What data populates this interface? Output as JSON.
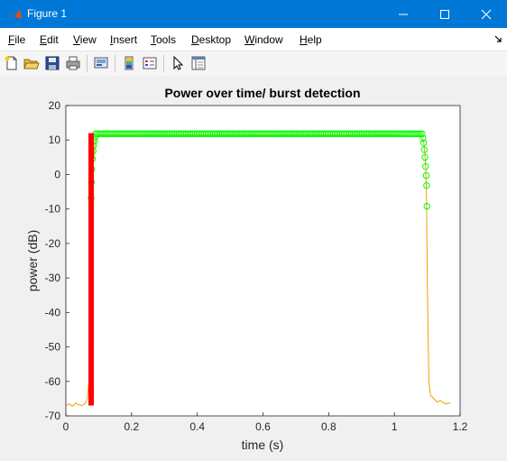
{
  "window": {
    "title": "Figure 1",
    "colors": {
      "titlebar": "#0078d7"
    }
  },
  "menu": {
    "items": [
      {
        "label": "File",
        "accel": "F",
        "rest": "ile"
      },
      {
        "label": "Edit",
        "accel": "E",
        "rest": "dit"
      },
      {
        "label": "View",
        "accel": "V",
        "rest": "iew"
      },
      {
        "label": "Insert",
        "accel": "I",
        "rest": "nsert"
      },
      {
        "label": "Tools",
        "accel": "T",
        "rest": "ools"
      },
      {
        "label": "Desktop",
        "accel": "D",
        "rest": "esktop"
      },
      {
        "label": "Window",
        "accel": "W",
        "rest": "indow"
      },
      {
        "label": "Help",
        "accel": "H",
        "rest": "elp"
      }
    ]
  },
  "toolbar": {
    "icons": [
      "new-figure-icon",
      "open-file-icon",
      "save-icon",
      "print-icon",
      "link-plot-icon",
      "insert-colorbar-icon",
      "insert-legend-icon",
      "edit-plot-icon",
      "property-inspector-icon"
    ]
  },
  "chart_data": {
    "type": "line",
    "title": "Power over time/ burst detection",
    "xlabel": "time (s)",
    "ylabel": "power (dB)",
    "xlim": [
      0,
      1.2
    ],
    "ylim": [
      -70,
      20
    ],
    "xticks": [
      "0",
      "0.2",
      "0.4",
      "0.6",
      "0.8",
      "1",
      "1.2"
    ],
    "yticks": [
      "20",
      "10",
      "0",
      "-10",
      "-20",
      "-30",
      "-40",
      "-50",
      "-60",
      "-70"
    ],
    "grid": false,
    "series": [
      {
        "kind": "line",
        "color": "#f0a000",
        "x": [
          0,
          0.01,
          0.02,
          0.03,
          0.04,
          0.05,
          0.06,
          0.065,
          0.07,
          0.073,
          0.075,
          0.078,
          0.08,
          0.082,
          0.085,
          0.088,
          0.09,
          0.095,
          0.1,
          0.2,
          0.4,
          0.6,
          0.8,
          1.0,
          1.08,
          1.085,
          1.09,
          1.093,
          1.095,
          1.097,
          1.098,
          1.1,
          1.105,
          1.11,
          1.12,
          1.13,
          1.14,
          1.15,
          1.16,
          1.17
        ],
        "y": [
          -67,
          -66.5,
          -67.2,
          -66.3,
          -66.8,
          -67,
          -66.4,
          -65,
          -60,
          -30,
          -12,
          -7,
          -2,
          2,
          5,
          8,
          10,
          11.2,
          11.5,
          11.5,
          11.5,
          11.5,
          11.5,
          11.5,
          11.2,
          10.5,
          9,
          6,
          2,
          -3,
          -9,
          -30,
          -60,
          -64,
          -65,
          -66,
          -65.5,
          -66.3,
          -66.5,
          -66.2
        ]
      },
      {
        "kind": "markers",
        "marker": "circle",
        "color": "#00ff00",
        "x_range": [
          0.09,
          1.085
        ],
        "y": 11.8,
        "edge_points": [
          {
            "x": 0.077,
            "y": -6.8
          },
          {
            "x": 0.078,
            "y": -2.2
          },
          {
            "x": 0.079,
            "y": 1.5
          },
          {
            "x": 0.081,
            "y": 4.5
          },
          {
            "x": 0.083,
            "y": 6.8
          },
          {
            "x": 0.085,
            "y": 8.5
          },
          {
            "x": 0.087,
            "y": 9.7
          },
          {
            "x": 0.089,
            "y": 10.8
          },
          {
            "x": 1.087,
            "y": 10.5
          },
          {
            "x": 1.089,
            "y": 9.2
          },
          {
            "x": 1.091,
            "y": 7.2
          },
          {
            "x": 1.093,
            "y": 5
          },
          {
            "x": 1.095,
            "y": 2.3
          },
          {
            "x": 1.097,
            "y": -0.3
          },
          {
            "x": 1.098,
            "y": -3.2
          },
          {
            "x": 1.099,
            "y": -9.2
          }
        ]
      },
      {
        "kind": "vline",
        "color": "#ff0000",
        "x": 0.077,
        "y_range": [
          -67,
          12
        ]
      }
    ]
  }
}
